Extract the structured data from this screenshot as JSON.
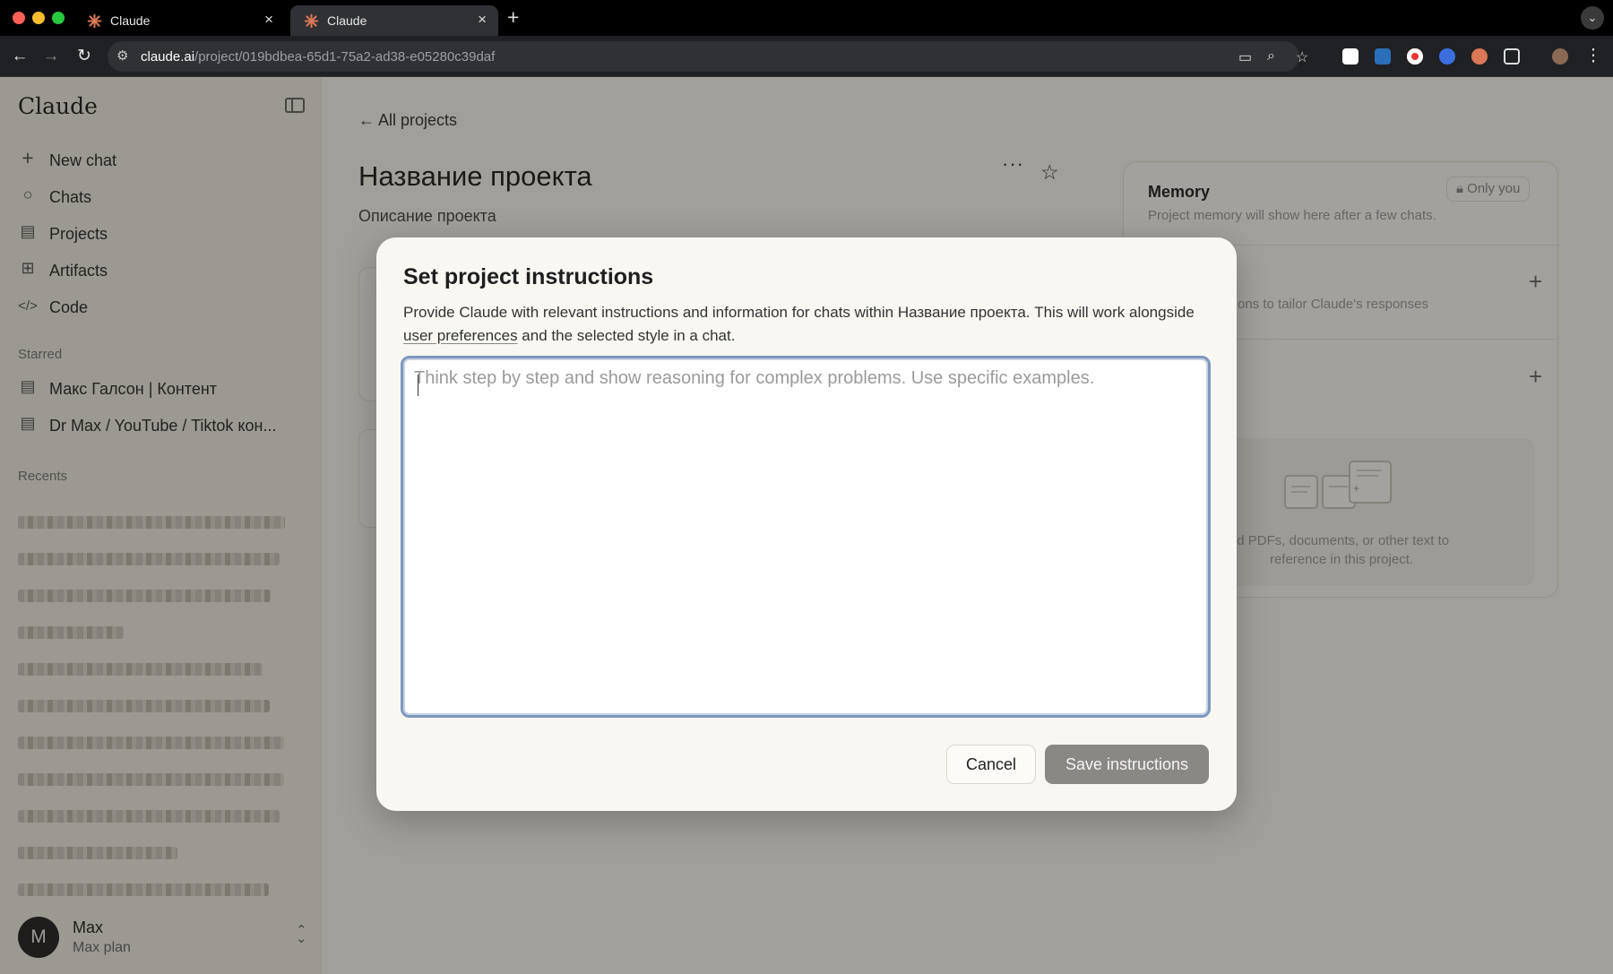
{
  "browser": {
    "tabs": [
      {
        "title": "Claude",
        "active": false
      },
      {
        "title": "Claude",
        "active": true
      }
    ],
    "url_host": "claude.ai",
    "url_path": "/project/019bdbea-65d1-75a2-ad38-e05280c39daf"
  },
  "sidebar": {
    "logo": "Claude",
    "nav": [
      {
        "label": "New chat",
        "icon": "plus-icon"
      },
      {
        "label": "Chats",
        "icon": "chat-bubble-icon"
      },
      {
        "label": "Projects",
        "icon": "folder-stack-icon"
      },
      {
        "label": "Artifacts",
        "icon": "grid-icon"
      },
      {
        "label": "Code",
        "icon": "code-icon"
      }
    ],
    "starred_heading": "Starred",
    "starred": [
      {
        "label": "Макс Галсон | Контент"
      },
      {
        "label": "Dr Max / YouTube / Tiktok кон..."
      }
    ],
    "recents_heading": "Recents",
    "user": {
      "initial": "M",
      "name": "Max",
      "plan": "Max plan"
    }
  },
  "main": {
    "back_label": "All projects",
    "project_title": "Название проекта",
    "project_description": "Описание проекта",
    "memory": {
      "heading": "Memory",
      "visibility": "Only you",
      "text": "Project memory will show here after a few chats."
    },
    "instructions_hint": "ons to tailor Claude's responses",
    "files_hint_line1": "ld PDFs, documents, or other text to",
    "files_hint_line2": "reference in this project."
  },
  "modal": {
    "title": "Set project instructions",
    "desc_part1": "Provide Claude with relevant instructions and information for chats within Название проекта. This will work alongside ",
    "desc_link": "user preferences",
    "desc_part2": " and the selected style in a chat.",
    "textarea_placeholder": "Think step by step and show reasoning for complex problems. Use specific examples.",
    "textarea_value": "",
    "cancel_label": "Cancel",
    "save_label": "Save instructions"
  }
}
